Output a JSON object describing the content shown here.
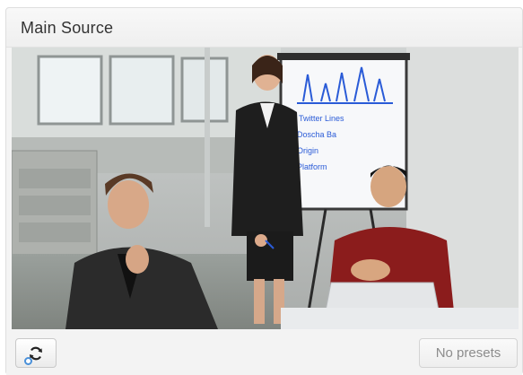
{
  "panel": {
    "title": "Main Source"
  },
  "video": {
    "description_icon": "camera-feed",
    "whiteboard_text": [
      "Twitter Lines",
      "Doscha Ba",
      "Origin",
      "Platform"
    ]
  },
  "footer": {
    "refresh_icon": "refresh-icon",
    "presets_label": "No presets"
  },
  "colors": {
    "focus_ring": "#4a90d9",
    "marker_blue": "#2a5bd7"
  }
}
